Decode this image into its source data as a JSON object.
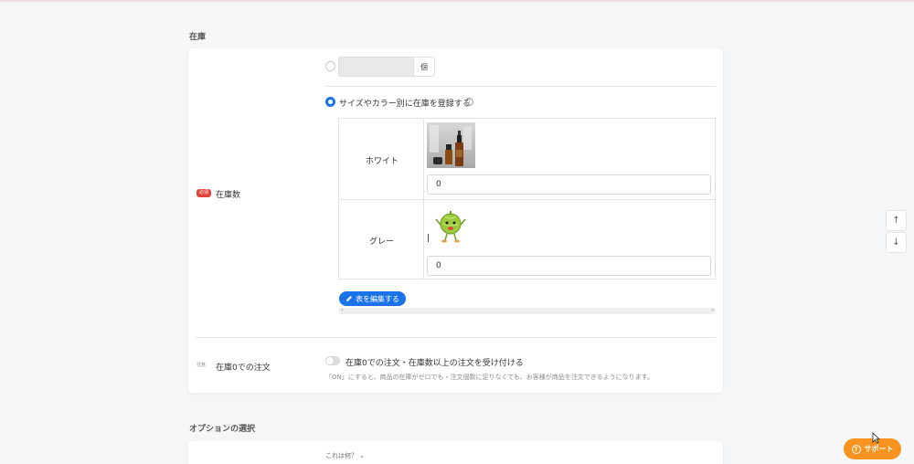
{
  "inventory_section": {
    "title": "在庫",
    "stock_count": {
      "required_badge": "必須",
      "label": "在庫数",
      "simple_option": {
        "unit": "個"
      },
      "variant_option": {
        "label": "サイズやカラー別に在庫を登録する",
        "help": "?"
      },
      "variants": [
        {
          "name": "ホワイト",
          "quantity": "0",
          "image": "serum-bottles-photo"
        },
        {
          "name": "グレー",
          "quantity": "0",
          "image": "melon-mascot-illustration"
        }
      ],
      "edit_table_button": "表を編集する"
    },
    "zero_stock_orders": {
      "optional_badge": "任意",
      "label": "在庫0での注文",
      "toggle_label": "在庫0での注文・在庫数以上の注文を受け付ける",
      "toggle_on": false,
      "note": "「ON」にすると、商品の在庫がゼロでも・注文個数に足りなくても、お客様が商品を注文できるようになります。"
    }
  },
  "options_section": {
    "title": "オプションの選択",
    "what_is_this": "これは何？"
  },
  "scroll_controls": {
    "up": "↑",
    "down": "↓"
  },
  "support_button": {
    "label": "サポート",
    "icon": "?"
  },
  "colors": {
    "accent": "#1a73e8",
    "support": "#f7931e",
    "required": "#e0453a"
  }
}
